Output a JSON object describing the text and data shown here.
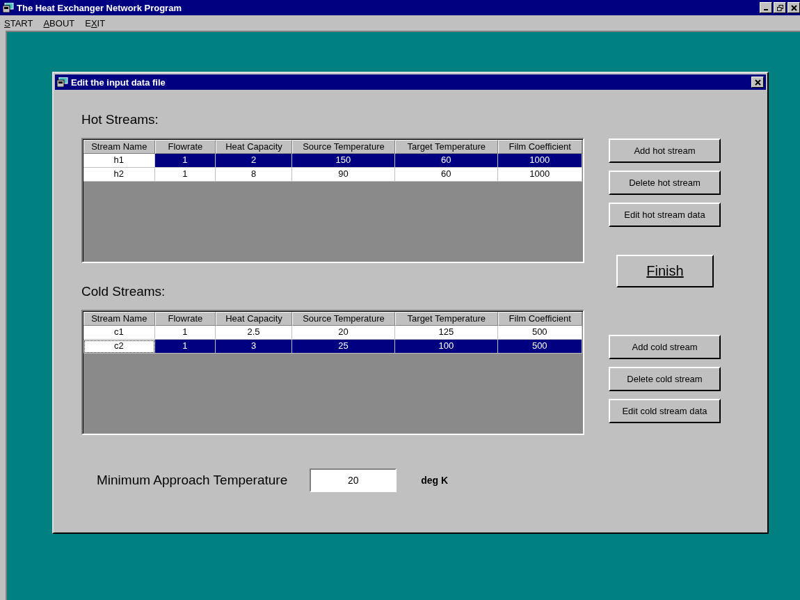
{
  "window": {
    "title": "The Heat Exchanger Network Program"
  },
  "menu": [
    {
      "key": "S",
      "after": "TART"
    },
    {
      "key": "A",
      "after": "BOUT"
    },
    {
      "before": "E",
      "key": "X",
      "after": "IT"
    }
  ],
  "dialog": {
    "title": "Edit the input data file",
    "hot_streams": {
      "label": "Hot Streams:",
      "columns": [
        "Stream Name",
        "Flowrate",
        "Heat Capacity",
        "Source Temperature",
        "Target Temperature",
        "Film Coefficient"
      ],
      "rows": [
        {
          "selected": true,
          "focused": false,
          "cells": [
            "h1",
            "1",
            "2",
            "150",
            "60",
            "1000"
          ]
        },
        {
          "selected": false,
          "focused": false,
          "cells": [
            "h2",
            "1",
            "8",
            "90",
            "60",
            "1000"
          ]
        }
      ]
    },
    "cold_streams": {
      "label": "Cold Streams:",
      "columns": [
        "Stream Name",
        "Flowrate",
        "Heat Capacity",
        "Source Temperature",
        "Target Temperature",
        "Film Coefficient"
      ],
      "rows": [
        {
          "selected": false,
          "focused": false,
          "cells": [
            "c1",
            "1",
            "2.5",
            "20",
            "125",
            "500"
          ]
        },
        {
          "selected": true,
          "focused": true,
          "cells": [
            "c2",
            "1",
            "3",
            "25",
            "100",
            "500"
          ]
        }
      ]
    },
    "hot_buttons": [
      "Add hot stream",
      "Delete hot stream",
      "Edit hot stream data"
    ],
    "finish_button": "Finish",
    "cold_buttons": [
      "Add cold stream",
      "Delete cold stream",
      "Edit cold stream data"
    ],
    "min_approach": {
      "label": "Minimum Approach Temperature",
      "value": "20",
      "unit": "deg K"
    }
  }
}
